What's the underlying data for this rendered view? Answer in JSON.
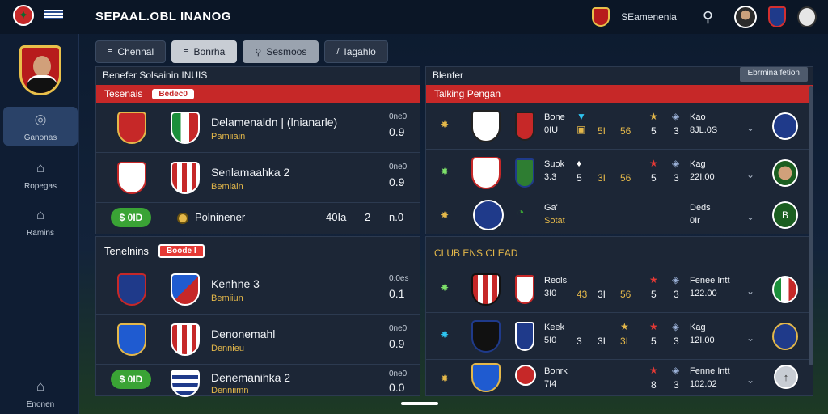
{
  "app": {
    "title": "SEPAAL.OBL INANOG"
  },
  "topbar": {
    "user_label": "SEamenenia",
    "search_icon": "search-icon"
  },
  "sidebar": {
    "items": [
      {
        "label": "Ganonas",
        "icon": "person-icon",
        "active": true
      },
      {
        "label": "Ropegas",
        "icon": "home-icon",
        "active": false
      },
      {
        "label": "Ramins",
        "icon": "home-icon",
        "active": false
      },
      {
        "label": "Enonen",
        "icon": "home-icon",
        "active": false
      }
    ]
  },
  "tabs": [
    {
      "icon": "≡",
      "label": "Chennal"
    },
    {
      "icon": "≡",
      "label": "Bonrha"
    },
    {
      "icon": "⚲",
      "label": "Sesmoos"
    },
    {
      "icon": "/",
      "label": "Iagahlo"
    }
  ],
  "left_top": {
    "header": "Benefer Solsainin INUIS",
    "bar_title": "Tesenais",
    "bar_chip": "Bedec0",
    "rows": [
      {
        "name": "Delamenaldn | (lnianarle)",
        "sub": "Pamiiain",
        "label": "0ne0",
        "value": "0.9"
      },
      {
        "name": "Senlamaahka 2",
        "sub": "Bemiain",
        "label": "0ne0",
        "value": "0.9"
      },
      {
        "pill": "$ 0ID",
        "name": "Polninener",
        "col1": "40Ia",
        "col2": "2",
        "value": "n.0"
      }
    ]
  },
  "left_bottom": {
    "bar_title": "Tenelnins",
    "bar_chip": "Boode I",
    "rows": [
      {
        "name": "Kenhne 3",
        "sub": "Bemiiun",
        "label": "0.0es",
        "value": "0.1"
      },
      {
        "name": "Denonemahl",
        "sub": "Dennieu",
        "label": "0ne0",
        "value": "0.9"
      },
      {
        "pill": "$ 0ID",
        "name": "Denemanihka 2",
        "sub": "Denniimn",
        "label": "0ne0",
        "value": "0.0"
      }
    ]
  },
  "right_top": {
    "header": "Blenfer",
    "header_button": "Ebrmina fetion",
    "bar_title": "Talking Pengan",
    "rows": [
      {
        "code": "Bone",
        "code2": "0IU",
        "n1": "5I",
        "n2": "56",
        "n3": "5",
        "n4": "3",
        "top": "Kao",
        "score": "8JL.0S"
      },
      {
        "code": "Suok",
        "code2": "3.3",
        "n1": "5",
        "n2": "3I",
        "n3": "56",
        "n4": "5",
        "n5": "3",
        "top": "Kag",
        "score": "22I.00"
      },
      {
        "code": "Ga'",
        "code2": "Sotat",
        "top": "Deds",
        "score": "0Ir"
      }
    ]
  },
  "right_bottom": {
    "bar_title": "CLUB ENS CLEAD",
    "rows": [
      {
        "code": "Reols",
        "code2": "3I0",
        "n1": "43",
        "n2": "3I",
        "n3": "56",
        "n4": "5",
        "n5": "3",
        "top": "Fenee Intt",
        "score": "122.00"
      },
      {
        "code": "Keek",
        "code2": "5I0",
        "n1": "3",
        "n2": "3I",
        "n3": "3I",
        "n4": "5",
        "n5": "3",
        "top": "Kag",
        "score": "12I.00"
      },
      {
        "code": "Bonrk",
        "code2": "7I4",
        "n4": "8",
        "n5": "3",
        "top": "Fenne Intt",
        "score": "102.02"
      }
    ]
  },
  "colors": {
    "accent_red": "#c62828",
    "gold": "#e4b84a",
    "green": "#3aa335",
    "panel": "#1c2636"
  }
}
